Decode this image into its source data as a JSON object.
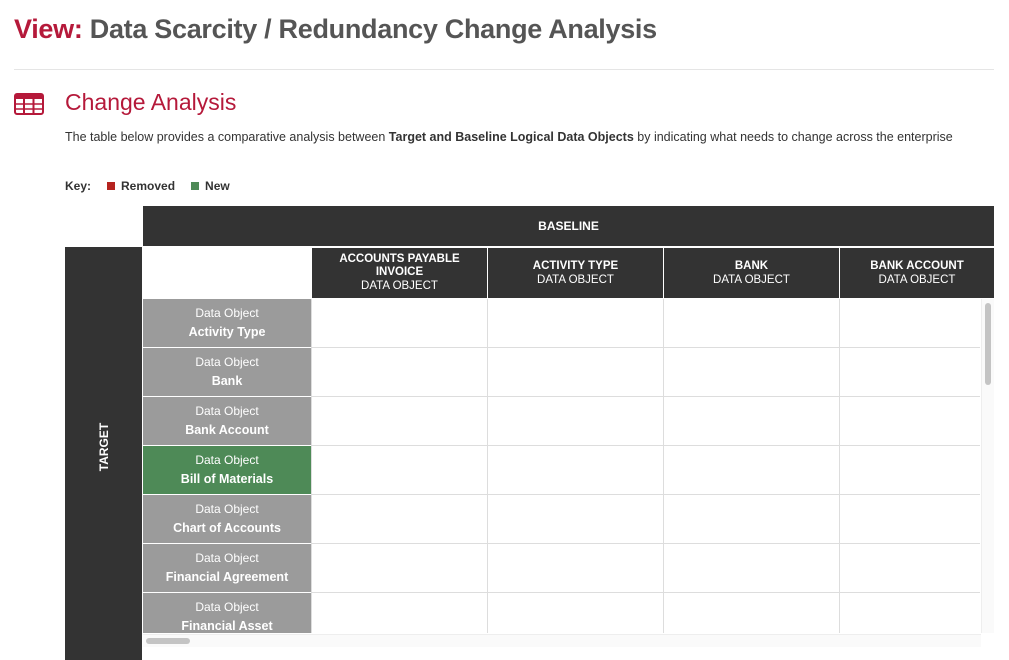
{
  "header": {
    "prefix": "View:",
    "title": "Data Scarcity / Redundancy Change Analysis"
  },
  "section": {
    "icon": "table-grid-icon",
    "title": "Change Analysis",
    "description_part1": "The table below provides a comparative analysis between ",
    "description_bold1": "Target and Baseline",
    "description_part2": " ",
    "description_bold2": "Logical Data Objects",
    "description_part3": " by indicating what needs to change across  the enterprise"
  },
  "key": {
    "label": "Key:",
    "items": [
      {
        "label": "Removed",
        "color": "#b5231f"
      },
      {
        "label": "New",
        "color": "#4e8a57"
      }
    ]
  },
  "matrix": {
    "baseline_label": "BASELINE",
    "target_label": "TARGET",
    "columns": [
      {
        "name": "ACCOUNTS PAYABLE INVOICE",
        "type": "DATA OBJECT"
      },
      {
        "name": "ACTIVITY TYPE",
        "type": "DATA OBJECT"
      },
      {
        "name": "BANK",
        "type": "DATA OBJECT"
      },
      {
        "name": "BANK ACCOUNT",
        "type": "DATA OBJECT"
      }
    ],
    "rows": [
      {
        "type": "Data Object",
        "name": "Activity Type",
        "status": "unchanged"
      },
      {
        "type": "Data Object",
        "name": "Bank",
        "status": "unchanged"
      },
      {
        "type": "Data Object",
        "name": "Bank Account",
        "status": "unchanged"
      },
      {
        "type": "Data Object",
        "name": "Bill of Materials",
        "status": "new"
      },
      {
        "type": "Data Object",
        "name": "Chart of Accounts",
        "status": "unchanged"
      },
      {
        "type": "Data Object",
        "name": "Financial Agreement",
        "status": "unchanged"
      },
      {
        "type": "Data Object",
        "name": "Financial Asset",
        "status": "unchanged"
      }
    ]
  },
  "colors": {
    "accent": "#b5193a",
    "header_dark": "#333333",
    "row_unchanged": "#9b9b9b",
    "row_new": "#4e8a57",
    "row_removed": "#b5231f"
  }
}
